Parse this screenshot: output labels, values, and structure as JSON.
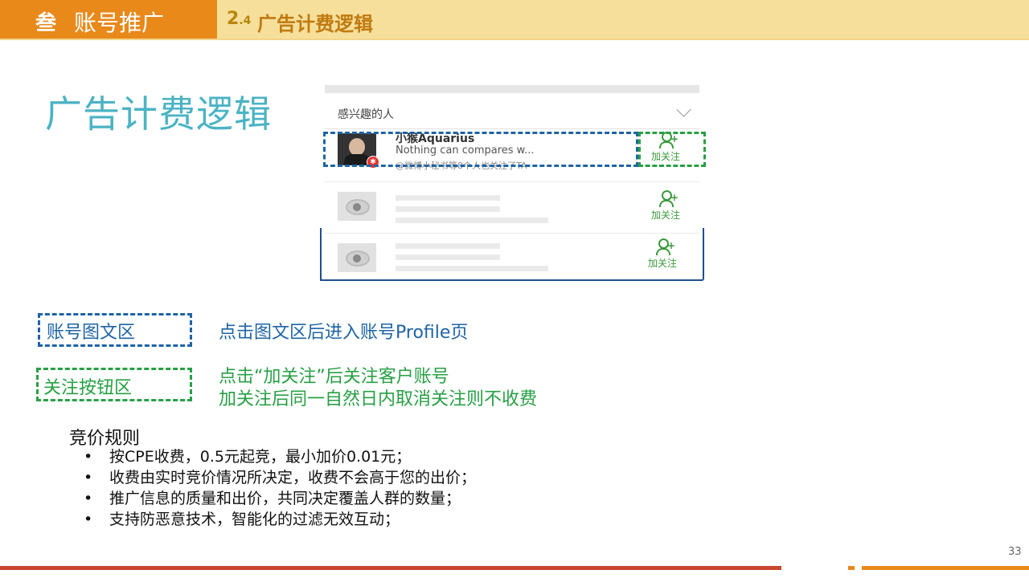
{
  "header": {
    "section_icon": "叁",
    "section_title": "账号推广",
    "sub_number": "2",
    "sub_number_small": ".4",
    "sub_title": "广告计费逻辑"
  },
  "page_title": "广告计费逻辑",
  "mock": {
    "head_text": "感兴趣的人",
    "user_name": "小猴Aquarius",
    "user_desc": "Nothing can compares w...",
    "user_meta": "@微博小秘书等8个人也关注了TA",
    "follow_label": "加关注"
  },
  "legend": {
    "blue_label": "账号图文区",
    "blue_desc": "点击图文区后进入账号Profile页",
    "green_label": "关注按钮区",
    "green_desc_1": "点击“加关注”后关注客户账号",
    "green_desc_2": "加关注后同一自然日内取消关注则不收费"
  },
  "rules": {
    "title": "竞价规则",
    "items": [
      "按CPE收费，0.5元起竞，最小加价0.01元；",
      "收费由实时竞价情况所决定，收费不会高于您的出价；",
      "推广信息的质量和出价，共同决定覆盖人群的数量；",
      "支持防恶意技术，智能化的过滤无效互动；"
    ]
  },
  "page_number": "33",
  "colors": {
    "accent_orange": "#e8891a",
    "title_teal": "#4bb3c4",
    "blue": "#1e64a6",
    "green": "#27a044"
  }
}
